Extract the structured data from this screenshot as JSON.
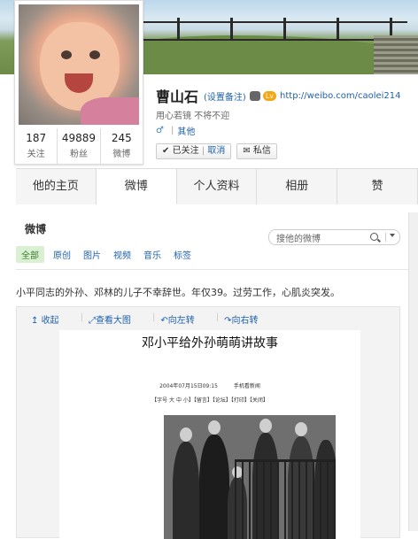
{
  "profile": {
    "name": "曹山石",
    "remark_link": "(设置备注)",
    "level_badge": "Lv",
    "url": "http://weibo.com/caolei214",
    "intro": "用心若镜 不将不迎",
    "gender_icon": "male-icon",
    "other_link": "其他",
    "stats": [
      {
        "num": "187",
        "label": "关注"
      },
      {
        "num": "49889",
        "label": "粉丝"
      },
      {
        "num": "245",
        "label": "微博"
      }
    ],
    "follow_label": "已关注",
    "cancel_label": "取消",
    "message_label": "私信"
  },
  "tabs": [
    "他的主页",
    "微博",
    "个人资料",
    "相册",
    "赞"
  ],
  "feed": {
    "title": "微博",
    "search_placeholder": "搜他的微博",
    "filters": [
      "全部",
      "原创",
      "图片",
      "视频",
      "音乐",
      "标签"
    ],
    "post_text": "小平同志的外孙、邓林的儿子不幸辞世。年仅39。过劳工作，心肌炎突发。",
    "pic_tools": [
      "收起",
      "查看大图",
      "向左转",
      "向右转"
    ],
    "pic_title": "邓小平给外孙萌萌讲故事",
    "pic_date": "2004年07月15日09:15　　　手机看新闻",
    "pic_links": "【字号 大 中 小】【留言】【论坛】【打印】【关闭】"
  },
  "colors": {
    "link": "#1f61ab",
    "level_badge": "#f3a712",
    "filter_active_bg": "#daf0d3"
  }
}
